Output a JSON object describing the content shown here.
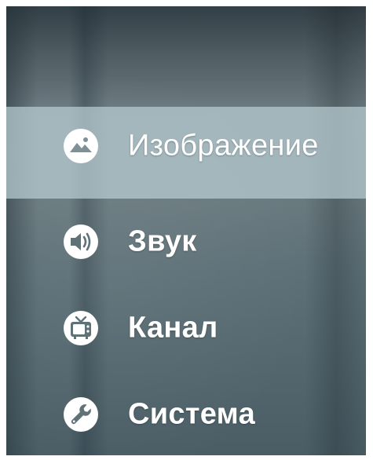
{
  "menu": {
    "items": [
      {
        "label": "Изображение",
        "icon": "image-icon",
        "selected": true
      },
      {
        "label": "Звук",
        "icon": "speaker-icon",
        "selected": false
      },
      {
        "label": "Канал",
        "icon": "tv-icon",
        "selected": false
      },
      {
        "label": "Система",
        "icon": "wrench-icon",
        "selected": false
      }
    ]
  },
  "colors": {
    "highlight": "#b9cdd2",
    "text": "#ffffff",
    "icon": "#ffffff",
    "background": "#5d7077"
  }
}
